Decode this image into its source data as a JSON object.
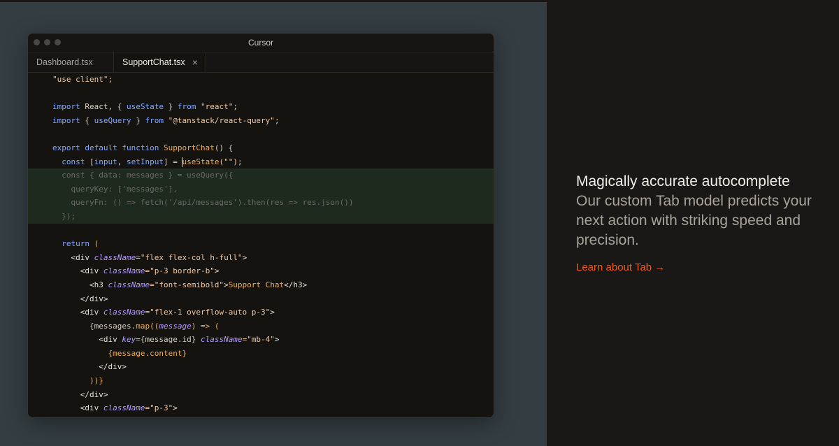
{
  "window": {
    "title": "Cursor",
    "tabs": [
      {
        "label": "Dashboard.tsx"
      },
      {
        "label": "SupportChat.tsx",
        "close": "×"
      }
    ]
  },
  "code": {
    "l1": "\"use client\";",
    "l2_kw": "import",
    "l2_a": " React, { ",
    "l2_b": "useState",
    "l2_c": " } ",
    "l2_from": "from",
    "l2_str": " \"react\"",
    "l2_end": ";",
    "l3_kw": "import",
    "l3_a": " { ",
    "l3_b": "useQuery",
    "l3_c": " } ",
    "l3_from": "from",
    "l3_str": " \"@tanstack/react-query\"",
    "l3_end": ";",
    "l4_kw": "export default function ",
    "l4_fn": "SupportChat",
    "l4_end": "() {",
    "l5_kw": "const",
    "l5_a": " [",
    "l5_b": "input",
    "l5_c": ", ",
    "l5_d": "setInput",
    "l5_e": "] = ",
    "l5_fn": "useState",
    "l5_str": "(\"\")",
    "l5_end": ";",
    "g1": "const { data: messages } = useQuery({",
    "g2": "queryKey: ['messages'],",
    "g3": "queryFn: () => fetch('/api/messages').then(res => res.json())",
    "g4": "});",
    "r1_kw": "return",
    "r1_end": " (",
    "d1_a": "<div ",
    "d1_attr": "className",
    "d1_val": "=\"flex flex-col h-full\"",
    "d1_end": ">",
    "d2_a": "<div ",
    "d2_attr": "className",
    "d2_val": "=\"p-3 border-b\"",
    "d2_end": ">",
    "h3_a": "<h3 ",
    "h3_attr": "className",
    "h3_val": "=\"font-semibold\"",
    "h3_b": ">",
    "h3_text": "Support Chat",
    "h3_end": "</h3>",
    "cd1": "</div>",
    "d3_a": "<div ",
    "d3_attr": "className",
    "d3_val": "=\"flex-1 overflow-auto p-3\"",
    "d3_end": ">",
    "m1_a": "{messages.",
    "m1_fn": "map",
    "m1_b": "((",
    "m1_attr": "message",
    "m1_c": ") => (",
    "k1_a": "<div ",
    "k1_attr1": "key",
    "k1_b": "={message.id} ",
    "k1_attr2": "className",
    "k1_val": "=\"mb-4\"",
    "k1_end": ">",
    "mc": "{message.content}",
    "cd2": "</div>",
    "cm": "))}",
    "cd3": "</div>",
    "d4_a": "<div ",
    "d4_attr": "className",
    "d4_val": "=\"p-3\"",
    "d4_end": ">"
  },
  "feature": {
    "heading": "Magically accurate autocomplete",
    "description": "Our custom Tab model predicts your next action with striking speed and precision.",
    "link": "Learn about Tab →"
  },
  "colors": {
    "accent": "#f2581c",
    "page_bg": "#1a1816",
    "stage_bg": "#333d42",
    "editor_bg": "#151310"
  }
}
